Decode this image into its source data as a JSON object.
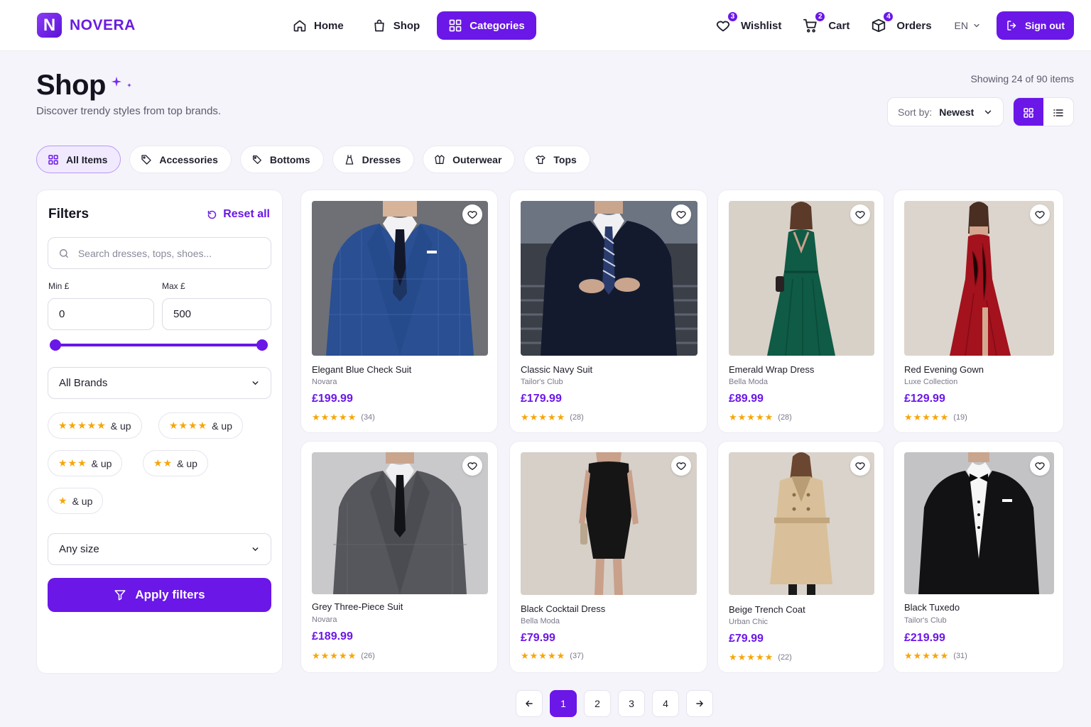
{
  "brand": {
    "logo_letter": "N",
    "name": "NOVERA"
  },
  "nav": {
    "items": [
      {
        "label": "Home",
        "icon": "home-icon"
      },
      {
        "label": "Shop",
        "icon": "shopping-bag-icon"
      },
      {
        "label": "Categories",
        "icon": "grid-icon",
        "active": true
      }
    ]
  },
  "user_nav": {
    "wishlist": {
      "label": "Wishlist",
      "count": "3"
    },
    "cart": {
      "label": "Cart",
      "count": "2"
    },
    "orders": {
      "label": "Orders",
      "count": "4"
    },
    "language": "EN",
    "sign_out": "Sign out"
  },
  "page": {
    "title": "Shop",
    "subtitle": "Discover trendy styles from top brands.",
    "showing": "Showing 24 of 90 items"
  },
  "sort": {
    "label": "Sort by:",
    "value": "Newest"
  },
  "view_mode": "grid",
  "categories": [
    {
      "label": "All Items",
      "icon": "grid-icon",
      "active": true
    },
    {
      "label": "Accessories",
      "icon": "tag-icon"
    },
    {
      "label": "Bottoms",
      "icon": "tag-outline-icon"
    },
    {
      "label": "Dresses",
      "icon": "dress-icon"
    },
    {
      "label": "Outerwear",
      "icon": "jacket-icon"
    },
    {
      "label": "Tops",
      "icon": "shirt-icon"
    }
  ],
  "filters": {
    "title": "Filters",
    "reset_label": "Reset all",
    "search_placeholder": "Search dresses, tops, shoes...",
    "min_label": "Min £",
    "max_label": "Max £",
    "min_value": "0",
    "max_value": "500",
    "brand_select": "All Brands",
    "ratings": [
      {
        "stars": "★★★★★",
        "label": "& up"
      },
      {
        "stars": "★★★★",
        "label": "& up"
      },
      {
        "stars": "★★★",
        "label": "& up"
      },
      {
        "stars": "★★",
        "label": "& up"
      },
      {
        "stars": "★",
        "label": "& up"
      }
    ],
    "size_select": "Any size",
    "apply_label": "Apply filters"
  },
  "products": [
    {
      "name": "Elegant Blue Check Suit",
      "brand": "Novara",
      "price": "£199.99",
      "stars": "★★★★★",
      "reviews": "(34)"
    },
    {
      "name": "Classic Navy Suit",
      "brand": "Tailor's Club",
      "price": "£179.99",
      "stars": "★★★★★",
      "reviews": "(28)"
    },
    {
      "name": "Emerald Wrap Dress",
      "brand": "Bella Moda",
      "price": "£89.99",
      "stars": "★★★★★",
      "reviews": "(28)"
    },
    {
      "name": "Red Evening Gown",
      "brand": "Luxe Collection",
      "price": "£129.99",
      "stars": "★★★★★",
      "reviews": "(19)"
    },
    {
      "name": "Grey Three-Piece Suit",
      "brand": "Novara",
      "price": "£189.99",
      "stars": "★★★★★",
      "reviews": "(26)"
    },
    {
      "name": "Black Cocktail Dress",
      "brand": "Bella Moda",
      "price": "£79.99",
      "stars": "★★★★★",
      "reviews": "(37)"
    },
    {
      "name": "Beige Trench Coat",
      "brand": "Urban Chic",
      "price": "£79.99",
      "stars": "★★★★★",
      "reviews": "(22)"
    },
    {
      "name": "Black Tuxedo",
      "brand": "Tailor's Club",
      "price": "£219.99",
      "stars": "★★★★★",
      "reviews": "(31)"
    }
  ],
  "pagination": {
    "pages": [
      "1",
      "2",
      "3",
      "4"
    ],
    "current": "1"
  },
  "colors": {
    "accent": "#6a17e8",
    "star": "#f6a609",
    "background": "#f5f4fa"
  }
}
